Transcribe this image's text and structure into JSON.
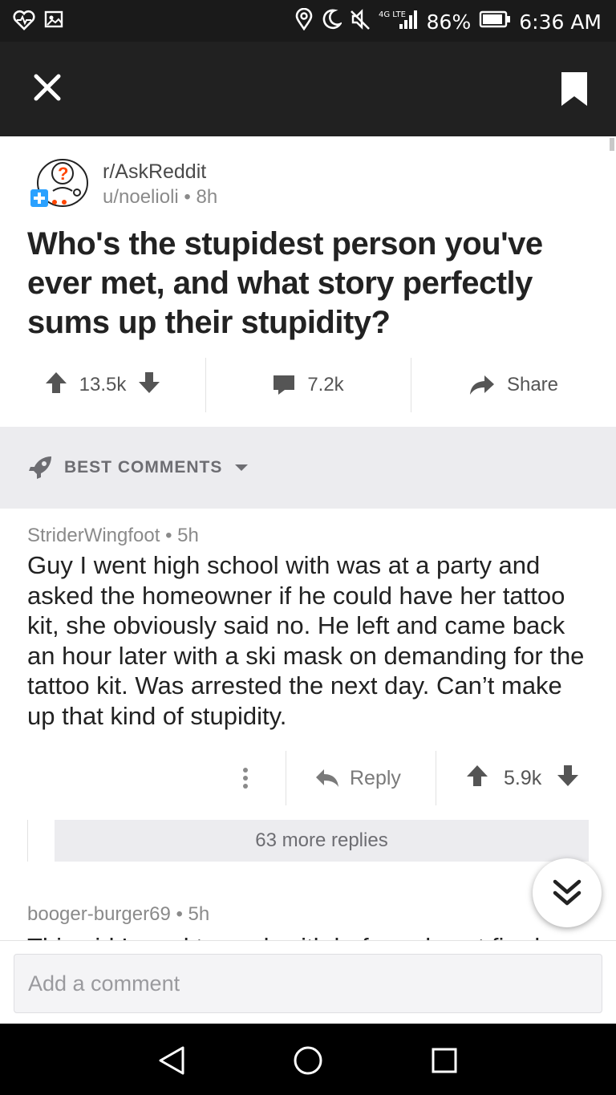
{
  "status_bar": {
    "left_icons": [
      "heart-pulse-icon",
      "gallery-icon"
    ],
    "right_icons": [
      "location-icon",
      "moon-icon",
      "mute-icon",
      "signal-icon",
      "battery-icon"
    ],
    "network": "4G LTE",
    "battery": "86%",
    "time": "6:36 AM"
  },
  "toolbar": {
    "close_icon": "close-icon",
    "bookmark_icon": "bookmark-icon"
  },
  "post": {
    "subreddit": "r/AskReddit",
    "author": "u/noelioli",
    "age": "8h",
    "title": "Who's the stupidest person you've ever met, and what story perfectly sums up their stupidity?",
    "upvotes": "13.5k",
    "comments": "7.2k",
    "share_label": "Share"
  },
  "sort": {
    "label": "BEST COMMENTS"
  },
  "comments": [
    {
      "author": "StriderWingfoot",
      "age": "5h",
      "body": "Guy I went high school with was at a party and asked the homeowner if he could have her tattoo kit, she obviously said no. He left and came back an hour later with a ski mask on demanding for the tattoo kit. Was arrested the next day. Can’t make up that kind of stupidity.",
      "reply_label": "Reply",
      "score": "5.9k",
      "more_replies": "63 more replies"
    },
    {
      "author": "booger-burger69",
      "age": "5h",
      "body_partial": "This girl I used to work with before almost fired"
    }
  ],
  "composer": {
    "placeholder": "Add a comment"
  },
  "colors": {
    "toolbar": "#212121",
    "statusbar": "#1a1a1a",
    "sort_bar": "#ececef",
    "text": "#222222",
    "meta": "#8a8a8a"
  }
}
